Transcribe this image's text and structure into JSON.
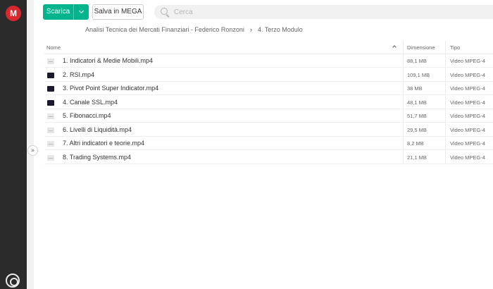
{
  "app": {
    "logo_text": "M"
  },
  "toolbar": {
    "download_label": "Scarica",
    "save_label": "Salva in MEGA"
  },
  "search": {
    "placeholder": "Cerca"
  },
  "breadcrumb": {
    "parent": "Analisi Tecnica dei Mercati Finanziari - Federico Ronzoni",
    "separator": "›",
    "current": "4. Terzo Modulo"
  },
  "table": {
    "columns": {
      "name": "Nome",
      "size": "Dimensione",
      "type": "Tipo"
    },
    "sort": {
      "column": "name",
      "direction": "ascending"
    },
    "rows": [
      {
        "name": "1. Indicatori & Medie Mobili.mp4",
        "size": "88,1 MB",
        "type": "Video MPEG-4",
        "thumb": "generic"
      },
      {
        "name": "2. RSI.mp4",
        "size": "109,1 MB",
        "type": "Video MPEG-4",
        "thumb": "video"
      },
      {
        "name": "3. Pivot Point Super Indicator.mp4",
        "size": "38 MB",
        "type": "Video MPEG-4",
        "thumb": "video"
      },
      {
        "name": "4. Canale SSL.mp4",
        "size": "48,1 MB",
        "type": "Video MPEG-4",
        "thumb": "video"
      },
      {
        "name": "5. Fibonacci.mp4",
        "size": "51,7 MB",
        "type": "Video MPEG-4",
        "thumb": "generic"
      },
      {
        "name": "6. Livelli di Liquidità.mp4",
        "size": "29,5 MB",
        "type": "Video MPEG-4",
        "thumb": "generic"
      },
      {
        "name": "7. Altri indicatori e teorie.mp4",
        "size": "8,2 MB",
        "type": "Video MPEG-4",
        "thumb": "generic"
      },
      {
        "name": "8. Trading Systems.mp4",
        "size": "21,1 MB",
        "type": "Video MPEG-4",
        "thumb": "generic"
      }
    ]
  },
  "icons": {
    "logo": "mega-logo-icon",
    "download_menu": "chevron-down-icon",
    "search": "search-icon",
    "collapse": "chevron-double-right-icon",
    "bottom": "transfers-icon",
    "sort": "chevron-up-icon"
  },
  "colors": {
    "brand": "#d9272e",
    "accent": "#00b58d",
    "rail": "#2b2b2b"
  }
}
